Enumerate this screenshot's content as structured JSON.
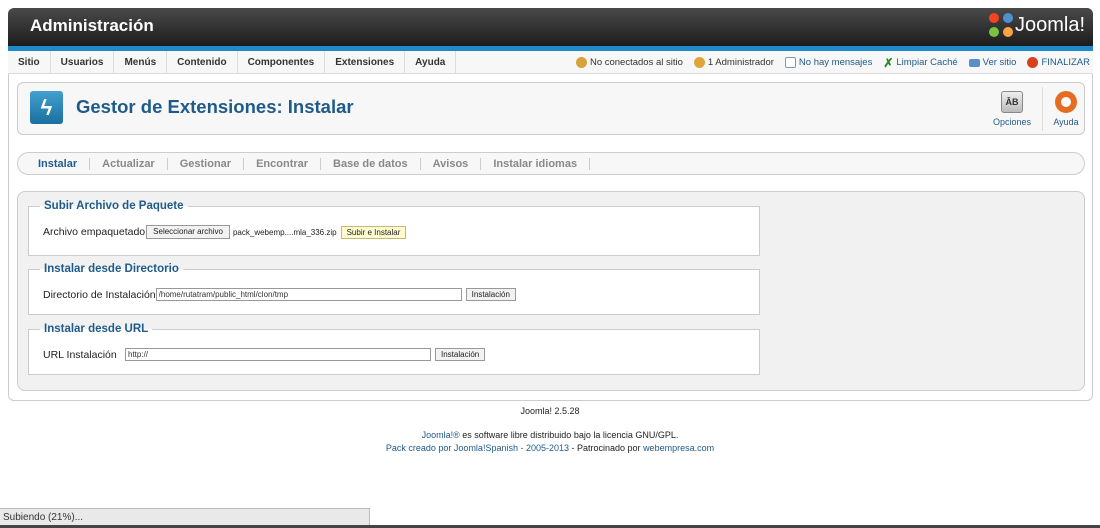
{
  "header": {
    "title": "Administración",
    "logo_text": "Joomla!"
  },
  "menu": {
    "items": [
      "Sitio",
      "Usuarios",
      "Menús",
      "Contenido",
      "Componentes",
      "Extensiones",
      "Ayuda"
    ]
  },
  "status": {
    "not_connected": "No conectados al sitio",
    "admins": "1 Administrador",
    "messages": "No hay mensajes",
    "clear_cache": "Limpiar Caché",
    "view_site": "Ver sitio",
    "logout": "FINALIZAR"
  },
  "toolbar": {
    "title": "Gestor de Extensiones: Instalar",
    "options_label": "Opciones",
    "help_label": "Ayuda"
  },
  "tabs": [
    "Instalar",
    "Actualizar",
    "Gestionar",
    "Encontrar",
    "Base de datos",
    "Avisos",
    "Instalar idiomas"
  ],
  "upload": {
    "legend": "Subir Archivo de Paquete",
    "label": "Archivo empaquetado",
    "choose_button": "Seleccionar archivo",
    "filename": "pack_webemp....mla_336.zip",
    "submit_button": "Subir e Instalar"
  },
  "directory": {
    "legend": "Instalar desde Directorio",
    "label": "Directorio de Instalación",
    "value": "/home/rutatram/public_html/clon/tmp",
    "button": "Instalación"
  },
  "url": {
    "legend": "Instalar desde URL",
    "label": "URL Instalación",
    "value": "http://",
    "button": "Instalación"
  },
  "footer": {
    "version": "Joomla! 2.5.28",
    "license_link": "Joomla!®",
    "license_text": " es software libre distribuido bajo la licencia GNU/GPL.",
    "pack_link": "Pack creado por Joomla!Spanish - 2005-2013",
    "sponsor_text": " - Patrocinado por ",
    "sponsor_link": "webempresa.com"
  },
  "browser_status": "Subiendo (21%)...",
  "colors": {
    "accent": "#1e8ac9",
    "title": "#1f5b8a",
    "header_bg": "#2a2a2a"
  }
}
